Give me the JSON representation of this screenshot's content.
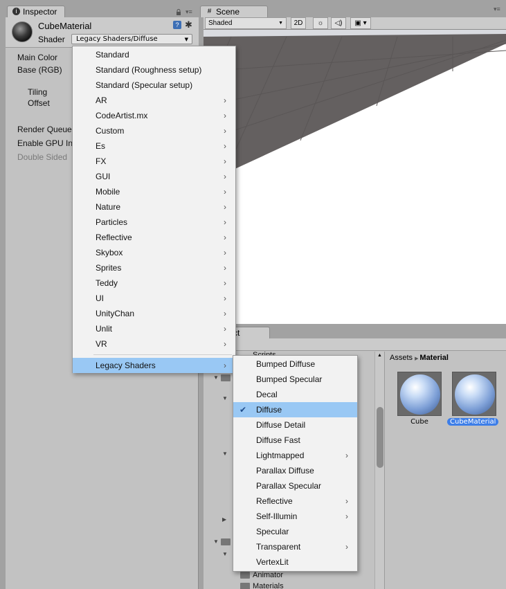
{
  "inspector": {
    "tab_label": "Inspector",
    "tab_icon": "info-icon",
    "material_name": "CubeMaterial",
    "shader_label": "Shader",
    "shader_value": "Legacy Shaders/Diffuse",
    "rows": [
      "Main Color",
      "Base (RGB)",
      "Tiling",
      "Offset",
      "Render Queue",
      "Enable GPU In",
      "Double Sided"
    ]
  },
  "scene": {
    "tab_label": "Scene",
    "tab_icon": "grid-icon",
    "shading_mode": "Shaded",
    "mode_2d": "2D"
  },
  "project": {
    "tab_label": "ct",
    "breadcrumb_root": "Assets",
    "breadcrumb_current": "Material",
    "tree_items": [
      "Scripts",
      "Animator",
      "Materials"
    ],
    "assets": [
      {
        "name": "Cube",
        "selected": false
      },
      {
        "name": "CubeMaterial",
        "selected": true
      }
    ]
  },
  "shader_menu": {
    "items": [
      {
        "label": "Standard",
        "submenu": false
      },
      {
        "label": "Standard (Roughness setup)",
        "submenu": false
      },
      {
        "label": "Standard (Specular setup)",
        "submenu": false
      },
      {
        "label": "AR",
        "submenu": true
      },
      {
        "label": "CodeArtist.mx",
        "submenu": true
      },
      {
        "label": "Custom",
        "submenu": true
      },
      {
        "label": "Es",
        "submenu": true
      },
      {
        "label": "FX",
        "submenu": true
      },
      {
        "label": "GUI",
        "submenu": true
      },
      {
        "label": "Mobile",
        "submenu": true
      },
      {
        "label": "Nature",
        "submenu": true
      },
      {
        "label": "Particles",
        "submenu": true
      },
      {
        "label": "Reflective",
        "submenu": true
      },
      {
        "label": "Skybox",
        "submenu": true
      },
      {
        "label": "Sprites",
        "submenu": true
      },
      {
        "label": "Teddy",
        "submenu": true
      },
      {
        "label": "UI",
        "submenu": true
      },
      {
        "label": "UnityChan",
        "submenu": true
      },
      {
        "label": "Unlit",
        "submenu": true
      },
      {
        "label": "VR",
        "submenu": true
      }
    ],
    "highlighted": {
      "label": "Legacy Shaders",
      "submenu": true
    }
  },
  "legacy_submenu": {
    "items": [
      {
        "label": "Bumped Diffuse",
        "submenu": false,
        "checked": false
      },
      {
        "label": "Bumped Specular",
        "submenu": false,
        "checked": false
      },
      {
        "label": "Decal",
        "submenu": false,
        "checked": false
      },
      {
        "label": "Diffuse",
        "submenu": false,
        "checked": true
      },
      {
        "label": "Diffuse Detail",
        "submenu": false,
        "checked": false
      },
      {
        "label": "Diffuse Fast",
        "submenu": false,
        "checked": false
      },
      {
        "label": "Lightmapped",
        "submenu": true,
        "checked": false
      },
      {
        "label": "Parallax Diffuse",
        "submenu": false,
        "checked": false
      },
      {
        "label": "Parallax Specular",
        "submenu": false,
        "checked": false
      },
      {
        "label": "Reflective",
        "submenu": true,
        "checked": false
      },
      {
        "label": "Self-Illumin",
        "submenu": true,
        "checked": false
      },
      {
        "label": "Specular",
        "submenu": false,
        "checked": false
      },
      {
        "label": "Transparent",
        "submenu": true,
        "checked": false
      },
      {
        "label": "VertexLit",
        "submenu": false,
        "checked": false
      }
    ]
  },
  "colors": {
    "highlight": "#99c8f4",
    "selected_asset": "#3d7ee8",
    "scene_ground": "#646060"
  }
}
